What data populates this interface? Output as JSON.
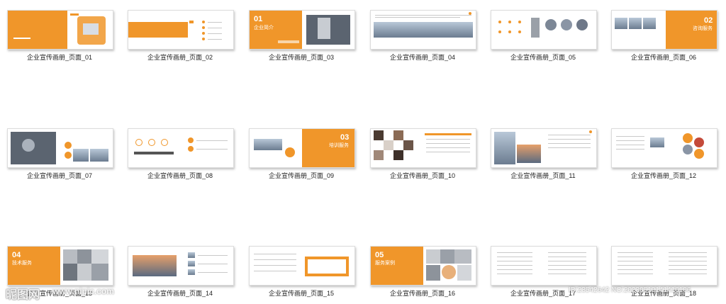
{
  "gallery": {
    "pages": [
      {
        "caption": "企业宣传画册_页面_01"
      },
      {
        "caption": "企业宣传画册_页面_02"
      },
      {
        "caption": "企业宣传画册_页面_03",
        "num": "01",
        "title": "企业简介"
      },
      {
        "caption": "企业宣传画册_页面_04"
      },
      {
        "caption": "企业宣传画册_页面_05"
      },
      {
        "caption": "企业宣传画册_页面_06",
        "num": "02",
        "title": "咨询服务"
      },
      {
        "caption": "企业宣传画册_页面_07"
      },
      {
        "caption": "企业宣传画册_页面_08"
      },
      {
        "caption": "企业宣传画册_页面_09",
        "num": "03",
        "title": "培训服务"
      },
      {
        "caption": "企业宣传画册_页面_10"
      },
      {
        "caption": "企业宣传画册_页面_11"
      },
      {
        "caption": "企业宣传画册_页面_12"
      },
      {
        "caption": "企业宣传画册_页面_13",
        "num": "04",
        "title": "技术服务"
      },
      {
        "caption": "企业宣传画册_页面_14"
      },
      {
        "caption": "企业宣传画册_页面_15"
      },
      {
        "caption": "企业宣传画册_页面_16",
        "num": "05",
        "title": "服务案例"
      },
      {
        "caption": "企业宣传画册_页面_17"
      },
      {
        "caption": "企业宣传画册_页面_18"
      }
    ]
  },
  "watermark": {
    "logo": "昵图网",
    "url": "www.nipic.com",
    "id": "ID:23542642 NO:20230510141416106"
  },
  "colors": {
    "accent": "#f0962a"
  }
}
